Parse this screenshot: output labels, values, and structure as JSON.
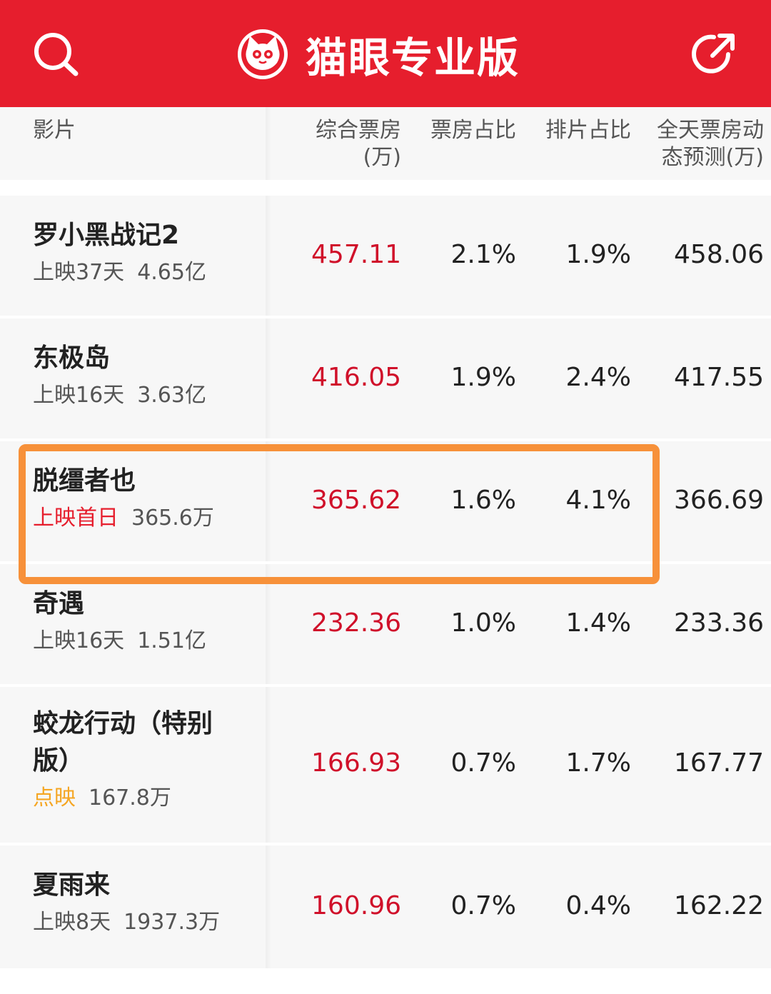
{
  "app": {
    "title": "猫眼专业版",
    "brand_color": "#E61E2D",
    "icons": {
      "search": "search-icon",
      "logo": "cat-logo-icon",
      "share": "share-icon"
    }
  },
  "table": {
    "headers": {
      "film": "影片",
      "box_office_line1": "综合票房",
      "box_office_line2": "(万)",
      "box_share": "票房占比",
      "schedule_share": "排片占比",
      "forecast_line1": "全天票房动",
      "forecast_line2": "态预测(万)"
    },
    "rows": [
      {
        "name": "罗小黑战记2",
        "status": "上映37天",
        "total": "4.65亿",
        "box_office": "457.11",
        "box_share": "2.1%",
        "schedule_share": "1.9%",
        "forecast": "458.06"
      },
      {
        "name": "东极岛",
        "status": "上映16天",
        "total": "3.63亿",
        "box_office": "416.05",
        "box_share": "1.9%",
        "schedule_share": "2.4%",
        "forecast": "417.55"
      },
      {
        "name": "脱缰者也",
        "status": "上映首日",
        "total": "365.6万",
        "box_office": "365.62",
        "box_share": "1.6%",
        "schedule_share": "4.1%",
        "forecast": "366.69"
      },
      {
        "name": "奇遇",
        "status": "上映16天",
        "total": "1.51亿",
        "box_office": "232.36",
        "box_share": "1.0%",
        "schedule_share": "1.4%",
        "forecast": "233.36"
      },
      {
        "name_line1": "蛟龙行动（特别",
        "name_line2": "版）",
        "status": "点映",
        "total": "167.8万",
        "box_office": "166.93",
        "box_share": "0.7%",
        "schedule_share": "1.7%",
        "forecast": "167.77"
      },
      {
        "name": "夏雨来",
        "status": "上映8天",
        "total": "1937.3万",
        "box_office": "160.96",
        "box_share": "0.7%",
        "schedule_share": "0.4%",
        "forecast": "162.22"
      }
    ],
    "highlight_color": "#F7913A",
    "status_colors": {
      "first_day": "#E61E2D",
      "preview": "#F5A623"
    }
  }
}
